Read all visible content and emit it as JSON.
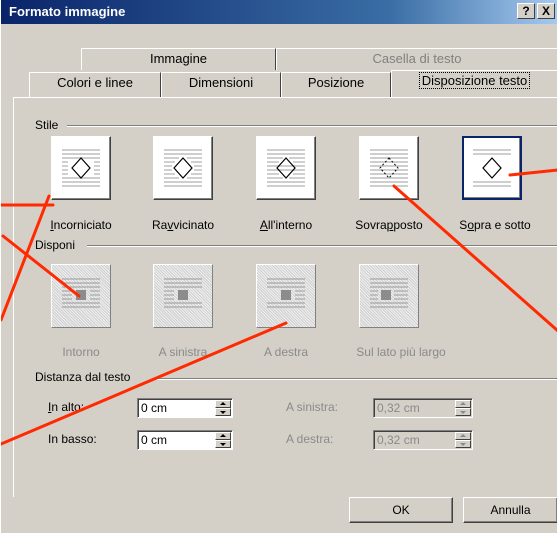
{
  "window": {
    "title": "Formato immagine",
    "help_label": "?",
    "close_label": "X"
  },
  "tabs_back": [
    {
      "label": "Immagine",
      "disabled": false
    },
    {
      "label": "Casella di testo",
      "disabled": true
    }
  ],
  "tabs_front": [
    {
      "label": "Colori e linee"
    },
    {
      "label": "Dimensioni"
    },
    {
      "label": "Posizione"
    },
    {
      "label": "Disposizione testo",
      "active": true
    }
  ],
  "stile": {
    "label": "Stile",
    "options": [
      {
        "label": "Incorniciato",
        "mnemonic": "I",
        "rest": "ncorniciato",
        "icon": "square-wrap-icon"
      },
      {
        "label": "Ravvicinato",
        "pre": "Ra",
        "mnemonic": "v",
        "rest": "vicinato",
        "icon": "tight-wrap-icon"
      },
      {
        "label": "All'interno",
        "mnemonic": "A",
        "rest": "ll'interno",
        "icon": "through-wrap-icon"
      },
      {
        "label": "Sovrapposto",
        "pre": "Sovra",
        "mnemonic": "p",
        "rest": "posto",
        "icon": "in-front-wrap-icon"
      },
      {
        "label": "Sopra e sotto",
        "pre": "S",
        "mnemonic": "o",
        "rest": "pra e sotto",
        "icon": "top-bottom-wrap-icon",
        "selected": true
      }
    ]
  },
  "disponi": {
    "label": "Disponi",
    "options": [
      {
        "label": "Intorno",
        "icon": "wrap-both-sides-icon"
      },
      {
        "label": "A sinistra",
        "icon": "wrap-left-icon"
      },
      {
        "label": "A destra",
        "icon": "wrap-right-icon"
      },
      {
        "label": "Sul lato più largo",
        "icon": "wrap-largest-side-icon"
      }
    ]
  },
  "distanza": {
    "label": "Distanza dal testo",
    "in_alto": {
      "label": "In alto:",
      "value": "0 cm"
    },
    "in_basso": {
      "label": "In basso:",
      "value": "0 cm"
    },
    "a_sinistra": {
      "label": "A sinistra:",
      "value": "0,32 cm"
    },
    "a_destra": {
      "label": "A destra:",
      "value": "0,32 cm"
    }
  },
  "buttons": {
    "ok": "OK",
    "annulla": "Annulla"
  },
  "colors": {
    "title_bar": "#0a246a",
    "annotation_arrow": "#ff2a00",
    "selection_border": "#0a246a"
  }
}
